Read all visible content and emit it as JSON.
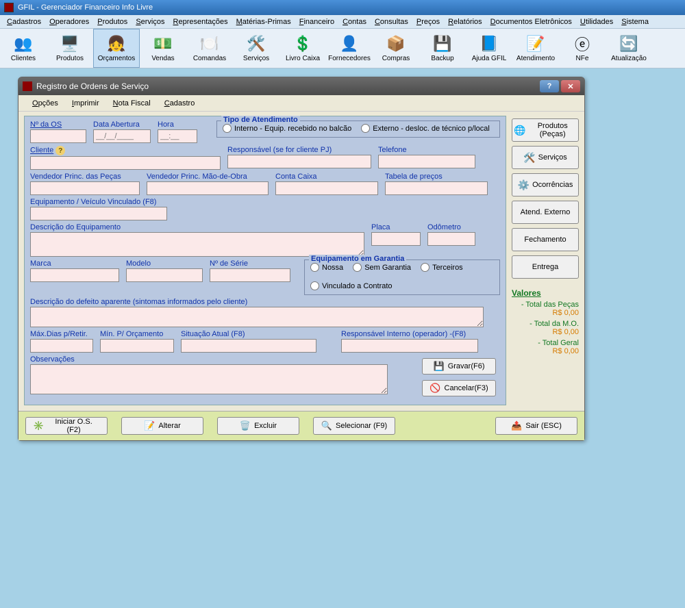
{
  "titlebar": {
    "text": "GFIL - Gerenciador Financeiro Info Livre"
  },
  "menus": [
    "Cadastros",
    "Operadores",
    "Produtos",
    "Serviços",
    "Representações",
    "Matérias-Primas",
    "Financeiro",
    "Contas",
    "Consultas",
    "Preços",
    "Relatórios",
    "Documentos Eletrônicos",
    "Utilidades",
    "Sistema"
  ],
  "toolbar": [
    {
      "label": "Clientes",
      "icon": "👥"
    },
    {
      "label": "Produtos",
      "icon": "🖥️"
    },
    {
      "label": "Orçamentos",
      "icon": "👧"
    },
    {
      "label": "Vendas",
      "icon": "💵"
    },
    {
      "label": "Comandas",
      "icon": "🍽️"
    },
    {
      "label": "Serviços",
      "icon": "🛠️"
    },
    {
      "label": "Livro Caixa",
      "icon": "💲"
    },
    {
      "label": "Fornecedores",
      "icon": "👤"
    },
    {
      "label": "Compras",
      "icon": "📦"
    },
    {
      "label": "Backup",
      "icon": "💾"
    },
    {
      "label": "Ajuda GFIL",
      "icon": "📘"
    },
    {
      "label": "Atendimento",
      "icon": "📝"
    },
    {
      "label": "NFe",
      "icon": "ⓔ"
    },
    {
      "label": "Atualização",
      "icon": "🔄"
    }
  ],
  "dialog": {
    "title": "Registro de Ordens de Serviço",
    "menus": [
      "Opções",
      "Imprimir",
      "Nota Fiscal",
      "Cadastro"
    ],
    "labels": {
      "num_os": "Nº da OS",
      "data_abertura": "Data Abertura",
      "data_placeholder": "__/__/____",
      "hora": "Hora",
      "hora_placeholder": "__:__",
      "tipo_atend": "Tipo de Atendimento",
      "interno": "Interno - Equip. recebido no balcão",
      "externo": "Externo - desloc. de técnico p/local",
      "cliente": "Cliente",
      "responsavel_pj": "Responsável (se for cliente PJ)",
      "telefone": "Telefone",
      "vend_pecas": "Vendedor Princ. das Peças",
      "vend_mo": "Vendedor Princ. Mão-de-Obra",
      "conta_caixa": "Conta Caixa",
      "tabela_precos": "Tabela de preços",
      "equip_vinc": "Equipamento / Veículo Vinculado (F8)",
      "desc_equip": "Descrição do Equipamento",
      "placa": "Placa",
      "odometro": "Odômetro",
      "marca": "Marca",
      "modelo": "Modelo",
      "num_serie": "Nº de Série",
      "garantia": "Equipamento em Garantia",
      "g_nossa": "Nossa",
      "g_sem": "Sem Garantia",
      "g_terc": "Terceiros",
      "g_contrato": "Vinculado a Contrato",
      "desc_defeito": "Descrição do defeito aparente (sintomas informados pelo cliente)",
      "max_dias": "Máx.Dias p/Retir.",
      "min_orc": "Mín. P/ Orçamento",
      "situacao": "Situação Atual (F8)",
      "resp_interno": "Responsável Interno (operador) -(F8)",
      "observacoes": "Observações",
      "gravar": "Gravar(F6)",
      "cancelar": "Cancelar(F3)"
    },
    "side": {
      "produtos": "Produtos (Peças)",
      "servicos": "Serviços",
      "ocorrencias": "Ocorrências",
      "atend_ext": "Atend. Externo",
      "fechamento": "Fechamento",
      "entrega": "Entrega"
    },
    "valores": {
      "title": "Valores",
      "pecas_label": "- Total das Peças",
      "pecas_val": "R$ 0,00",
      "mo_label": "- Total da M.O.",
      "mo_val": "R$ 0,00",
      "geral_label": "- Total Geral",
      "geral_val": "R$ 0,00"
    },
    "bottom": {
      "iniciar": "Iniciar O.S. (F2)",
      "alterar": "Alterar",
      "excluir": "Excluir",
      "selecionar": "Selecionar (F9)",
      "sair": "Sair (ESC)"
    }
  }
}
